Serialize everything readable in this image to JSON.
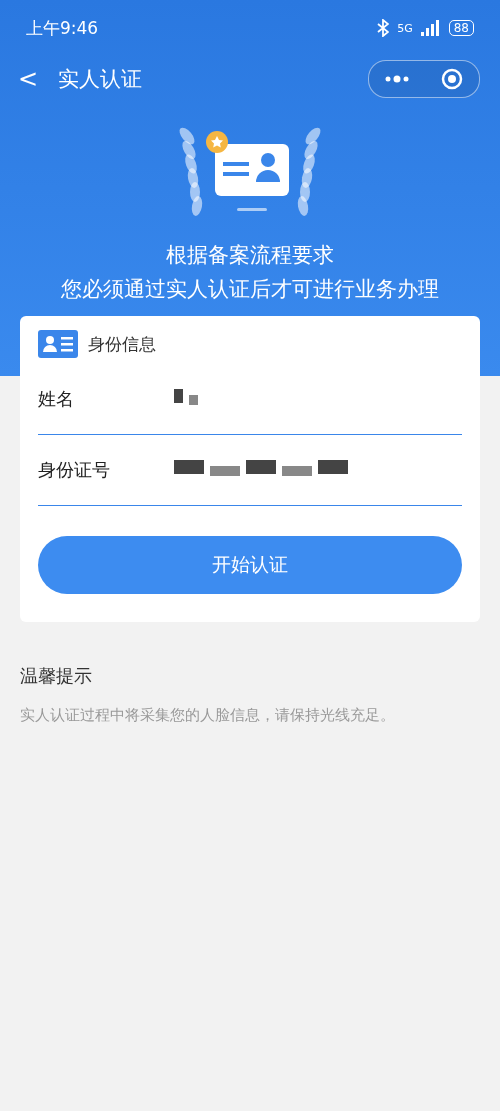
{
  "status_bar": {
    "time": "上午9:46",
    "network": "5G",
    "battery": "88"
  },
  "nav": {
    "back": "<",
    "title": "实人认证"
  },
  "hero": {
    "lines": [
      "根据备案流程要求",
      "您必须通过实人认证后才可进行业务办理"
    ]
  },
  "card": {
    "title": "身份信息",
    "fields": [
      {
        "label": "姓名",
        "masked": true
      },
      {
        "label": "身份证号",
        "masked": true
      }
    ],
    "button": "开始认证"
  },
  "tips": {
    "title": "温馨提示",
    "text": "实人认证过程中将采集您的人脸信息，请保持光线充足。"
  }
}
